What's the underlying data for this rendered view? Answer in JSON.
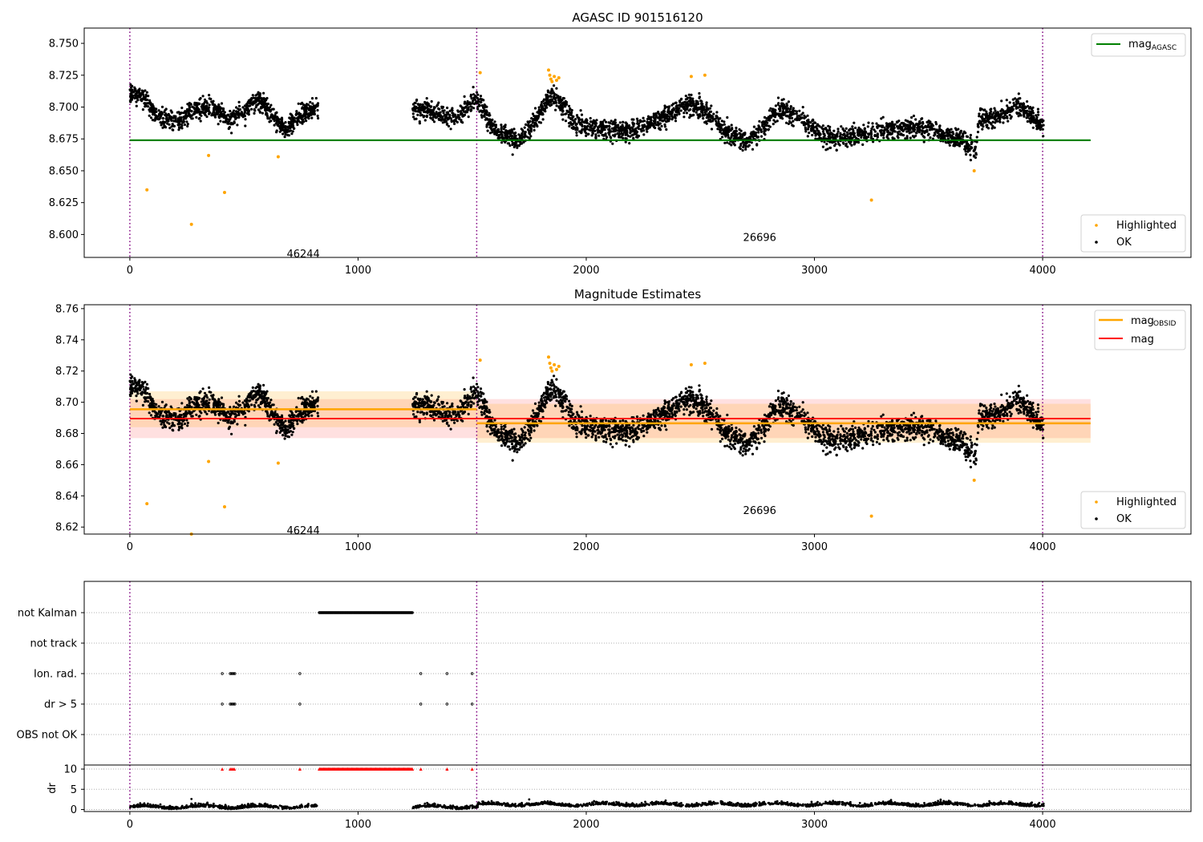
{
  "chart_data": [
    {
      "type": "scatter",
      "title": "AGASC ID 901516120",
      "xlim": [
        -200,
        4650
      ],
      "ylim": [
        8.582,
        8.762
      ],
      "x_ticks": [
        0,
        1000,
        2000,
        3000,
        4000
      ],
      "y_ticks": [
        8.6,
        8.625,
        8.65,
        8.675,
        8.7,
        8.725,
        8.75
      ],
      "y_tick_labels": [
        "8.600",
        "8.625",
        "8.650",
        "8.675",
        "8.700",
        "8.725",
        "8.750"
      ],
      "obsid_boundaries": [
        0,
        1520,
        4000
      ],
      "obsid_labels": [
        {
          "text": "46244",
          "x": 760,
          "y": 8.585
        },
        {
          "text": "26696",
          "x": 2760,
          "y": 8.598
        }
      ],
      "reference_lines": [
        {
          "name": "mag_AGASC",
          "y": 8.674,
          "x_range": [
            0,
            4210
          ],
          "color": "#008000"
        }
      ],
      "legend_top": [
        {
          "label": "mag",
          "sub": "AGASC",
          "color": "#008000"
        }
      ],
      "legend_bottom": [
        {
          "label": "Highlighted",
          "color": "#ffa500"
        },
        {
          "label": "OK",
          "color": "#000000"
        }
      ],
      "series": [
        {
          "name": "OK",
          "color": "#000000",
          "description": "dense light curve points, mean ~8.69, std ~0.012"
        },
        {
          "name": "Highlighted",
          "color": "#ffa500",
          "x": [
            75,
            270,
            345,
            415,
            650,
            1535,
            1835,
            1840,
            1845,
            1850,
            1860,
            1870,
            1880,
            2460,
            2520,
            3250,
            3700
          ],
          "y": [
            8.635,
            8.608,
            8.662,
            8.633,
            8.661,
            8.727,
            8.729,
            8.725,
            8.722,
            8.72,
            8.724,
            8.721,
            8.723,
            8.724,
            8.725,
            8.627,
            8.65
          ]
        }
      ]
    },
    {
      "type": "scatter",
      "title": "Magnitude Estimates",
      "xlim": [
        -200,
        4650
      ],
      "ylim": [
        8.6155,
        8.7625
      ],
      "x_ticks": [
        0,
        1000,
        2000,
        3000,
        4000
      ],
      "y_ticks": [
        8.62,
        8.64,
        8.66,
        8.68,
        8.7,
        8.72,
        8.74,
        8.76
      ],
      "y_tick_labels": [
        "8.62",
        "8.64",
        "8.66",
        "8.68",
        "8.70",
        "8.72",
        "8.74",
        "8.76"
      ],
      "obsid_boundaries": [
        0,
        1520,
        4000
      ],
      "obsid_labels": [
        {
          "text": "46244",
          "x": 760,
          "y": 8.618
        },
        {
          "text": "26696",
          "x": 2760,
          "y": 8.631
        }
      ],
      "bands": [
        {
          "name": "mag",
          "y": 8.6895,
          "low": 8.677,
          "high": 8.702,
          "x_range": [
            0,
            4210
          ],
          "color": "#ff0000"
        },
        {
          "name": "mag_OBSID 46244",
          "y": 8.6955,
          "low": 8.684,
          "high": 8.707,
          "x_range": [
            0,
            1520
          ],
          "color": "#ffa500"
        },
        {
          "name": "mag_OBSID 26696",
          "y": 8.6865,
          "low": 8.674,
          "high": 8.699,
          "x_range": [
            1520,
            4210
          ],
          "color": "#ffa500"
        }
      ],
      "legend_top": [
        {
          "label": "mag",
          "sub": "OBSID",
          "color": "#ffa500"
        },
        {
          "label": "mag",
          "sub": "",
          "color": "#ff0000"
        }
      ],
      "legend_bottom": [
        {
          "label": "Highlighted",
          "color": "#ffa500"
        },
        {
          "label": "OK",
          "color": "#000000"
        }
      ]
    },
    {
      "type": "scatter",
      "title": "",
      "xlim": [
        -200,
        4650
      ],
      "categories": [
        "not Kalman",
        "not track",
        "Ion. rad.",
        "dr > 5",
        "OBS not OK"
      ],
      "flag_segments": {
        "not Kalman": [
          [
            830,
            1240
          ]
        ],
        "Ion. rad.": [
          [
            405,
            405
          ],
          [
            440,
            460
          ],
          [
            745,
            745
          ],
          [
            1275,
            1275
          ],
          [
            1390,
            1390
          ],
          [
            1500,
            1500
          ]
        ],
        "dr > 5": [
          [
            405,
            405
          ],
          [
            440,
            460
          ],
          [
            745,
            745
          ],
          [
            1275,
            1275
          ],
          [
            1390,
            1390
          ],
          [
            1500,
            1500
          ]
        ]
      },
      "dr_ylabel": "dr",
      "dr_ylim": [
        -0.5,
        11
      ],
      "dr_ticks": [
        0,
        5,
        10
      ],
      "dr_clip": 10,
      "x_ticks": [
        0,
        1000,
        2000,
        3000,
        4000
      ]
    }
  ]
}
